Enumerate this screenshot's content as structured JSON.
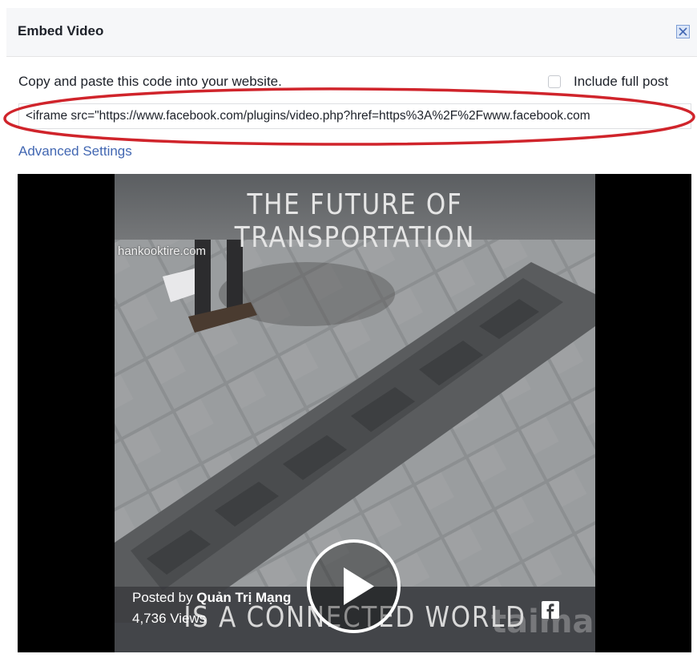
{
  "dialog": {
    "title": "Embed Video",
    "close_icon": "close-icon"
  },
  "embed": {
    "instructions": "Copy and paste this code into your website.",
    "include_full_post_label": "Include full post",
    "include_full_post_checked": false,
    "code_value": "<iframe src=\"https://www.facebook.com/plugins/video.php?href=https%3A%2F%2Fwww.facebook.com",
    "advanced_settings_label": "Advanced Settings",
    "highlight_color": "#d0242b"
  },
  "video": {
    "title_text": "THE FUTURE OF TRANSPORTATION",
    "site_watermark": "hankooktire.com",
    "subtitle_text": "IS A CONNECTED WORLD",
    "posted_by_prefix": "Posted by",
    "posted_by_name": "Quản Trị Mạng",
    "views": "4,736 Views",
    "brand_watermark": "taimang",
    "play_icon": "play-icon",
    "facebook_icon": "facebook-icon"
  },
  "colors": {
    "link": "#4267b2",
    "header_bg": "#f6f7f9",
    "text": "#1d2129"
  }
}
